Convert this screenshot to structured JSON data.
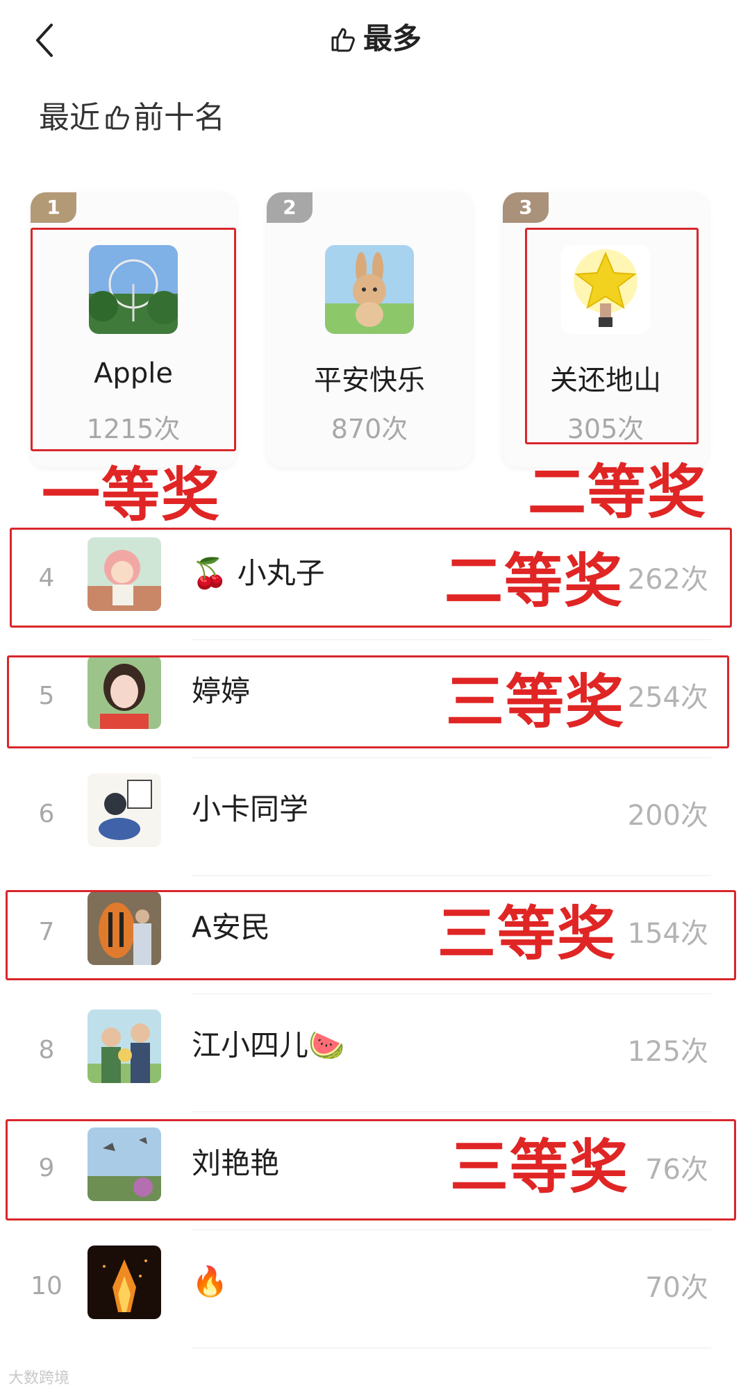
{
  "header": {
    "title": "最多"
  },
  "section_title": {
    "before": "最近",
    "after": "前十名"
  },
  "top3": [
    {
      "rank": "1",
      "name": "Apple",
      "count": "1215次"
    },
    {
      "rank": "2",
      "name": "平安快乐",
      "count": "870次"
    },
    {
      "rank": "3",
      "name": "关还地山",
      "count": "305次"
    }
  ],
  "rows": [
    {
      "rank": "4",
      "name": "🍒 小丸子",
      "count": "262次"
    },
    {
      "rank": "5",
      "name": "婷婷",
      "count": "254次"
    },
    {
      "rank": "6",
      "name": "小卡同学",
      "count": "200次"
    },
    {
      "rank": "7",
      "name": "A安民",
      "count": "154次"
    },
    {
      "rank": "8",
      "name": "江小四儿🍉",
      "count": "125次"
    },
    {
      "rank": "9",
      "name": "刘艳艳",
      "count": "76次"
    },
    {
      "rank": "10",
      "name": "🔥",
      "count": "70次"
    }
  ],
  "annotations": {
    "first": "一等奖",
    "second_a": "二等奖",
    "second_b": "二等奖",
    "third_a": "三等奖",
    "third_b": "三等奖",
    "third_c": "三等奖"
  },
  "watermark": "大数跨境",
  "colors": {
    "annotation_red": "#d8262b",
    "gold_badge": "#b39a77",
    "silver_badge": "#a7a7a7",
    "bronze_badge": "#a9917a",
    "muted_text": "#a8a8a8"
  }
}
